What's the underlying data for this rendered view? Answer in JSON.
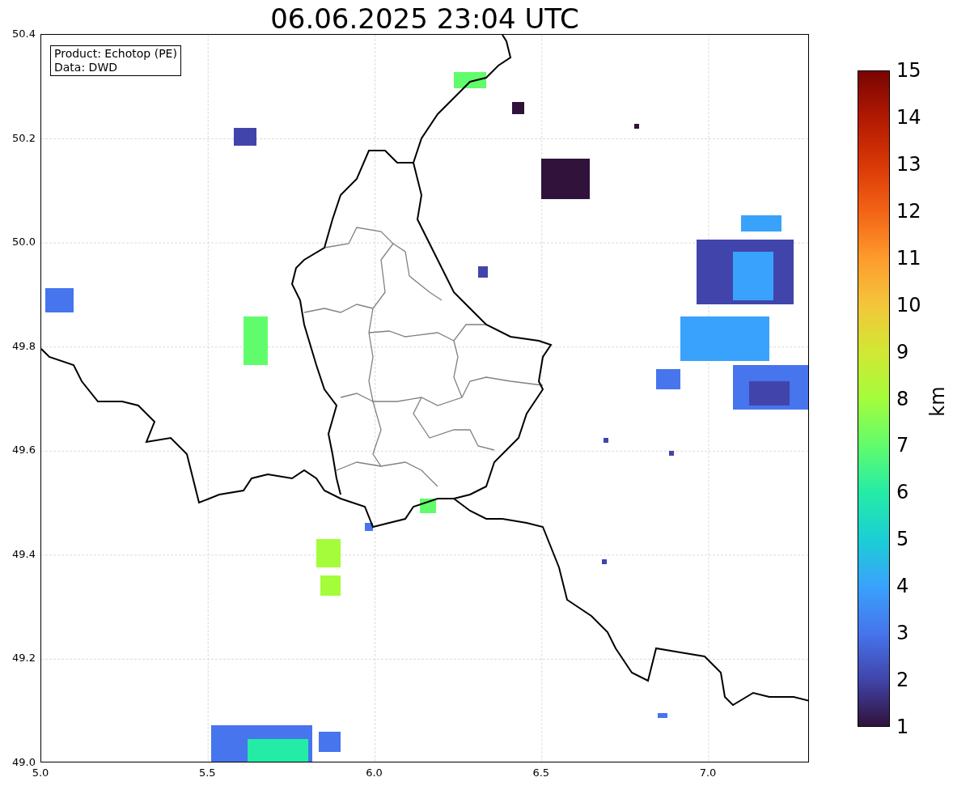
{
  "title": "06.06.2025 23:04 UTC",
  "legend": [
    "Product: Echotop (PE)",
    "Data: DWD"
  ],
  "axes": {
    "x_ticks": [
      "5.0",
      "5.5",
      "6.0",
      "6.5",
      "7.0"
    ],
    "y_ticks": [
      "50.4",
      "50.2",
      "50.0",
      "49.8",
      "49.6",
      "49.4",
      "49.2",
      "49.0"
    ]
  },
  "colorbar": {
    "label": "km",
    "ticks": [
      "15",
      "14",
      "13",
      "12",
      "11",
      "10",
      "9",
      "8",
      "7",
      "6",
      "5",
      "4",
      "3",
      "2",
      "1"
    ]
  }
}
